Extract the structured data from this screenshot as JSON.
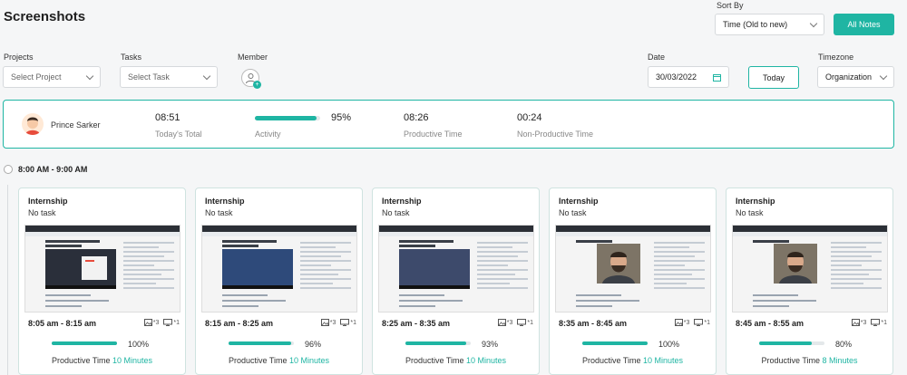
{
  "header": {
    "title": "Screenshots",
    "sort_by_label": "Sort By",
    "sort_value": "Time (Old to new)",
    "all_notes_label": "All Notes"
  },
  "filters": {
    "projects_label": "Projects",
    "projects_placeholder": "Select Project",
    "tasks_label": "Tasks",
    "tasks_placeholder": "Select Task",
    "member_label": "Member",
    "date_label": "Date",
    "date_value": "30/03/2022",
    "today_label": "Today",
    "timezone_label": "Timezone",
    "timezone_value": "Organization"
  },
  "summary": {
    "name": "Prince Sarker",
    "total_value": "08:51",
    "total_label": "Today's Total",
    "activity_percent": 95,
    "activity_percent_text": "95%",
    "activity_label": "Activity",
    "productive_value": "08:26",
    "productive_label": "Productive Time",
    "nonproductive_value": "00:24",
    "nonproductive_label": "Non-Productive Time"
  },
  "time_slot": "8:00 AM - 9:00 AM",
  "cards": [
    {
      "project": "Internship",
      "task": "No task",
      "time": "8:05 am - 8:15 am",
      "screens": "*3",
      "monitors": "*1",
      "percent": 100,
      "percent_text": "100%",
      "prod_label": "Productive Time",
      "prod_value": "10 Minutes",
      "thumb": "slides"
    },
    {
      "project": "Internship",
      "task": "No task",
      "time": "8:15 am - 8:25 am",
      "screens": "*3",
      "monitors": "*1",
      "percent": 96,
      "percent_text": "96%",
      "prod_label": "Productive Time",
      "prod_value": "10 Minutes",
      "thumb": "slides"
    },
    {
      "project": "Internship",
      "task": "No task",
      "time": "8:25 am - 8:35 am",
      "screens": "*3",
      "monitors": "*1",
      "percent": 93,
      "percent_text": "93%",
      "prod_label": "Productive Time",
      "prod_value": "10 Minutes",
      "thumb": "dark"
    },
    {
      "project": "Internship",
      "task": "No task",
      "time": "8:35 am - 8:45 am",
      "screens": "*3",
      "monitors": "*1",
      "percent": 100,
      "percent_text": "100%",
      "prod_label": "Productive Time",
      "prod_value": "10 Minutes",
      "thumb": "face"
    },
    {
      "project": "Internship",
      "task": "No task",
      "time": "8:45 am - 8:55 am",
      "screens": "*3",
      "monitors": "*1",
      "percent": 80,
      "percent_text": "80%",
      "prod_label": "Productive Time",
      "prod_value": "8 Minutes",
      "thumb": "face"
    }
  ],
  "colors": {
    "accent": "#1fb5a3",
    "border": "#cfe3e0"
  }
}
